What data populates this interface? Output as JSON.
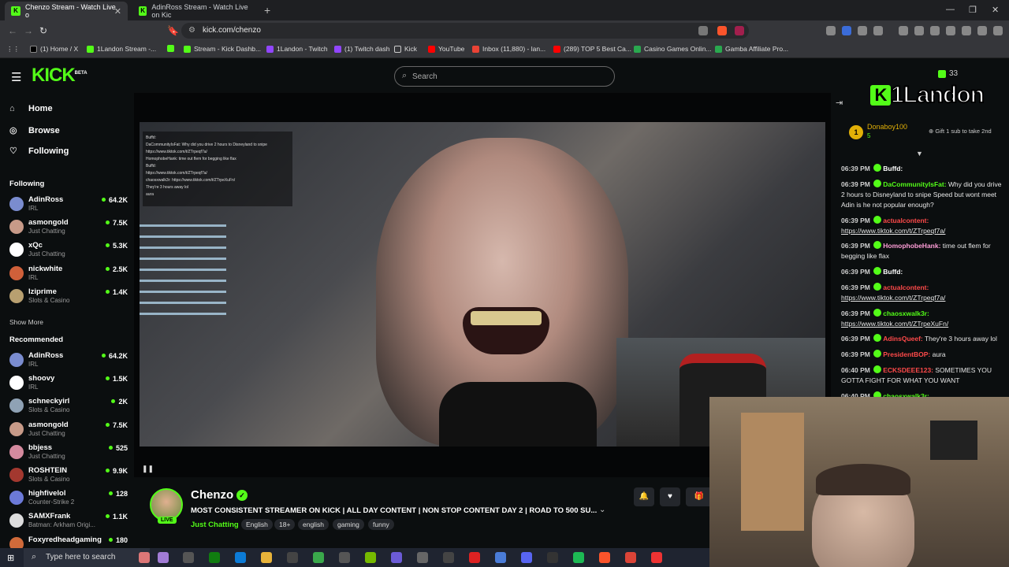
{
  "browser": {
    "tabs": [
      {
        "label": "Chenzo Stream - Watch Live o",
        "active": true
      },
      {
        "label": "AdinRoss Stream - Watch Live on Kic",
        "active": false
      }
    ],
    "url": "kick.com/chenzo",
    "bookmarks": [
      "(1) Home / X",
      "1Landon Stream -...",
      "Stream - Kick Dashb...",
      "1Landon - Twitch",
      "(1) Twitch dash",
      "Kick",
      "YouTube",
      "Inbox (11,880) - lan...",
      "(289) TOP 5 Best Ca...",
      "Casino Games Onlin...",
      "Gamba Affiliate Pro..."
    ]
  },
  "site": {
    "logo": "KICK",
    "logo_beta": "BETA",
    "search_placeholder": "Search",
    "header_count": "33"
  },
  "sidebar": {
    "nav": [
      {
        "label": "Home",
        "icon": "home-icon"
      },
      {
        "label": "Browse",
        "icon": "compass-icon"
      },
      {
        "label": "Following",
        "icon": "heart-icon"
      }
    ],
    "following_title": "Following",
    "following": [
      {
        "name": "AdinRoss",
        "category": "IRL",
        "viewers": "64.2K",
        "color": "#7a8ccf"
      },
      {
        "name": "asmongold",
        "category": "Just Chatting",
        "viewers": "7.5K",
        "color": "#c79a88"
      },
      {
        "name": "xQc",
        "category": "Just Chatting",
        "viewers": "5.3K",
        "color": "#ffffff"
      },
      {
        "name": "nickwhite",
        "category": "IRL",
        "viewers": "2.5K",
        "color": "#d0603a"
      },
      {
        "name": "lziprime",
        "category": "Slots & Casino",
        "viewers": "1.4K",
        "color": "#b8a070"
      }
    ],
    "show_more": "Show More",
    "recommended_title": "Recommended",
    "recommended": [
      {
        "name": "AdinRoss",
        "category": "IRL",
        "viewers": "64.2K",
        "color": "#7a8ccf"
      },
      {
        "name": "shoovy",
        "category": "IRL",
        "viewers": "1.5K",
        "color": "#ffffff"
      },
      {
        "name": "schneckyirl",
        "category": "Slots & Casino",
        "viewers": "2K",
        "color": "#8fa2b5"
      },
      {
        "name": "asmongold",
        "category": "Just Chatting",
        "viewers": "7.5K",
        "color": "#c79a88"
      },
      {
        "name": "bbjess",
        "category": "Just Chatting",
        "viewers": "525",
        "color": "#d48a9e"
      },
      {
        "name": "ROSHTEIN",
        "category": "Slots & Casino",
        "viewers": "9.9K",
        "color": "#a3382f"
      },
      {
        "name": "highfivelol",
        "category": "Counter-Strike 2",
        "viewers": "128",
        "color": "#6c7ad8"
      },
      {
        "name": "SAMXFrank",
        "category": "Batman: Arkham Origi...",
        "viewers": "1.1K",
        "color": "#dddddd"
      },
      {
        "name": "Foxyredheadgaming",
        "category": "",
        "viewers": "180",
        "color": "#d06a3a"
      }
    ]
  },
  "video_chat_overlay": [
    "Buffd:",
    "DaCommunityIsFat: Why did you drive 2 hours to Disneyland to snipe",
    "https://www.tiktok.com/t/ZTrpeqf7a/",
    "HomophobeHank: time out flem for begging like flax",
    "Buffd:",
    "https://www.tiktok.com/t/ZTrpeqf7a/",
    "chaosxwalk3r: https://www.tiktok.com/t/ZTrpeXuFn/",
    "They're 3 hours away lol",
    "aura"
  ],
  "stream": {
    "streamer": "Chenzo",
    "live": "LIVE",
    "title": "MOST CONSISTENT STREAMER ON KICK | ALL DAY CONTENT | NON STOP CONTENT DAY 2 | ROAD TO 500 SU...",
    "category": "Just Chatting",
    "tags": [
      "English",
      "18+",
      "english",
      "gaming",
      "funny"
    ]
  },
  "chat": {
    "pinned": {
      "name": "Donaboy100",
      "badge": "1",
      "sub": "5",
      "gift_text": "Gift 1 sub to take 2nd"
    },
    "messages": [
      {
        "time": "06:39 PM",
        "user": "Buffd:",
        "color": "#ffffff",
        "text": ""
      },
      {
        "time": "06:39 PM",
        "user": "DaCommunityIsFat:",
        "color": "#53fc18",
        "text": " Why did you drive 2 hours to Disneyland to snipe Speed but wont meet Adin is he not popular enough?"
      },
      {
        "time": "06:39 PM",
        "user": "actualcontent:",
        "color": "#ff4a4a",
        "text": "",
        "link": "https://www.tiktok.com/t/ZTrpeqf7a/"
      },
      {
        "time": "06:39 PM",
        "user": "HomophobeHank:",
        "color": "#ff9ed8",
        "text": " time out flem for begging like flax"
      },
      {
        "time": "06:39 PM",
        "user": "Buffd:",
        "color": "#ffffff",
        "text": ""
      },
      {
        "time": "06:39 PM",
        "user": "actualcontent:",
        "color": "#ff4a4a",
        "text": "",
        "link": "https://www.tiktok.com/t/ZTrpeqf7a/"
      },
      {
        "time": "06:39 PM",
        "user": "chaosxwalk3r:",
        "color": "#53fc18",
        "text": "",
        "link": "https://www.tiktok.com/t/ZTrpeXuFn/"
      },
      {
        "time": "06:39 PM",
        "user": "AdinsQueef:",
        "color": "#ff4a4a",
        "text": " They're 3 hours away lol"
      },
      {
        "time": "06:39 PM",
        "user": "PresidentBOP:",
        "color": "#ff4a4a",
        "text": " aura"
      },
      {
        "time": "06:40 PM",
        "user": "ECKSDEEE123:",
        "color": "#ff4a4a",
        "text": " SOMETIMES YOU GOTTA FIGHT FOR WHAT YOU WANT"
      },
      {
        "time": "06:40 PM",
        "user": "chaosxwalk3r:",
        "color": "#53fc18",
        "text": ""
      }
    ]
  },
  "overlay_logo": "1Landon",
  "taskbar": {
    "search_placeholder": "Type here to search"
  }
}
